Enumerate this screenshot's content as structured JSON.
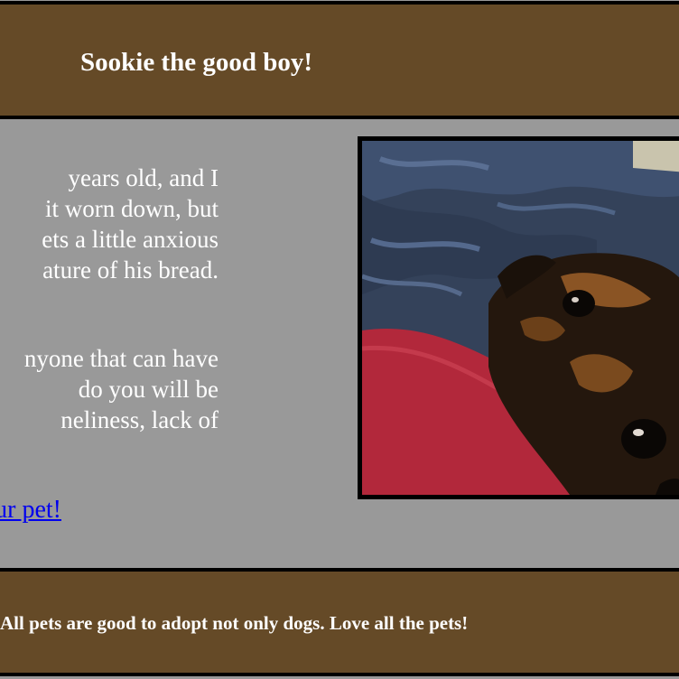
{
  "header": {
    "title": "Sookie the good boy!"
  },
  "story": {
    "paragraph1_lines": [
      "years old, and I",
      "it worn down, but",
      "ets a little anxious",
      "ature of his bread."
    ],
    "paragraph2_lines": [
      "nyone that can have",
      " do you will be",
      "neliness, lack of"
    ]
  },
  "adopt_link": {
    "label": "ur pet!"
  },
  "photo": {
    "subject": "dog-photo"
  },
  "footer": {
    "text": "All pets are good to adopt not only dogs. Love all the pets!"
  },
  "colors": {
    "banner": "#654a27",
    "background": "#999999",
    "link": "#0000ee"
  }
}
